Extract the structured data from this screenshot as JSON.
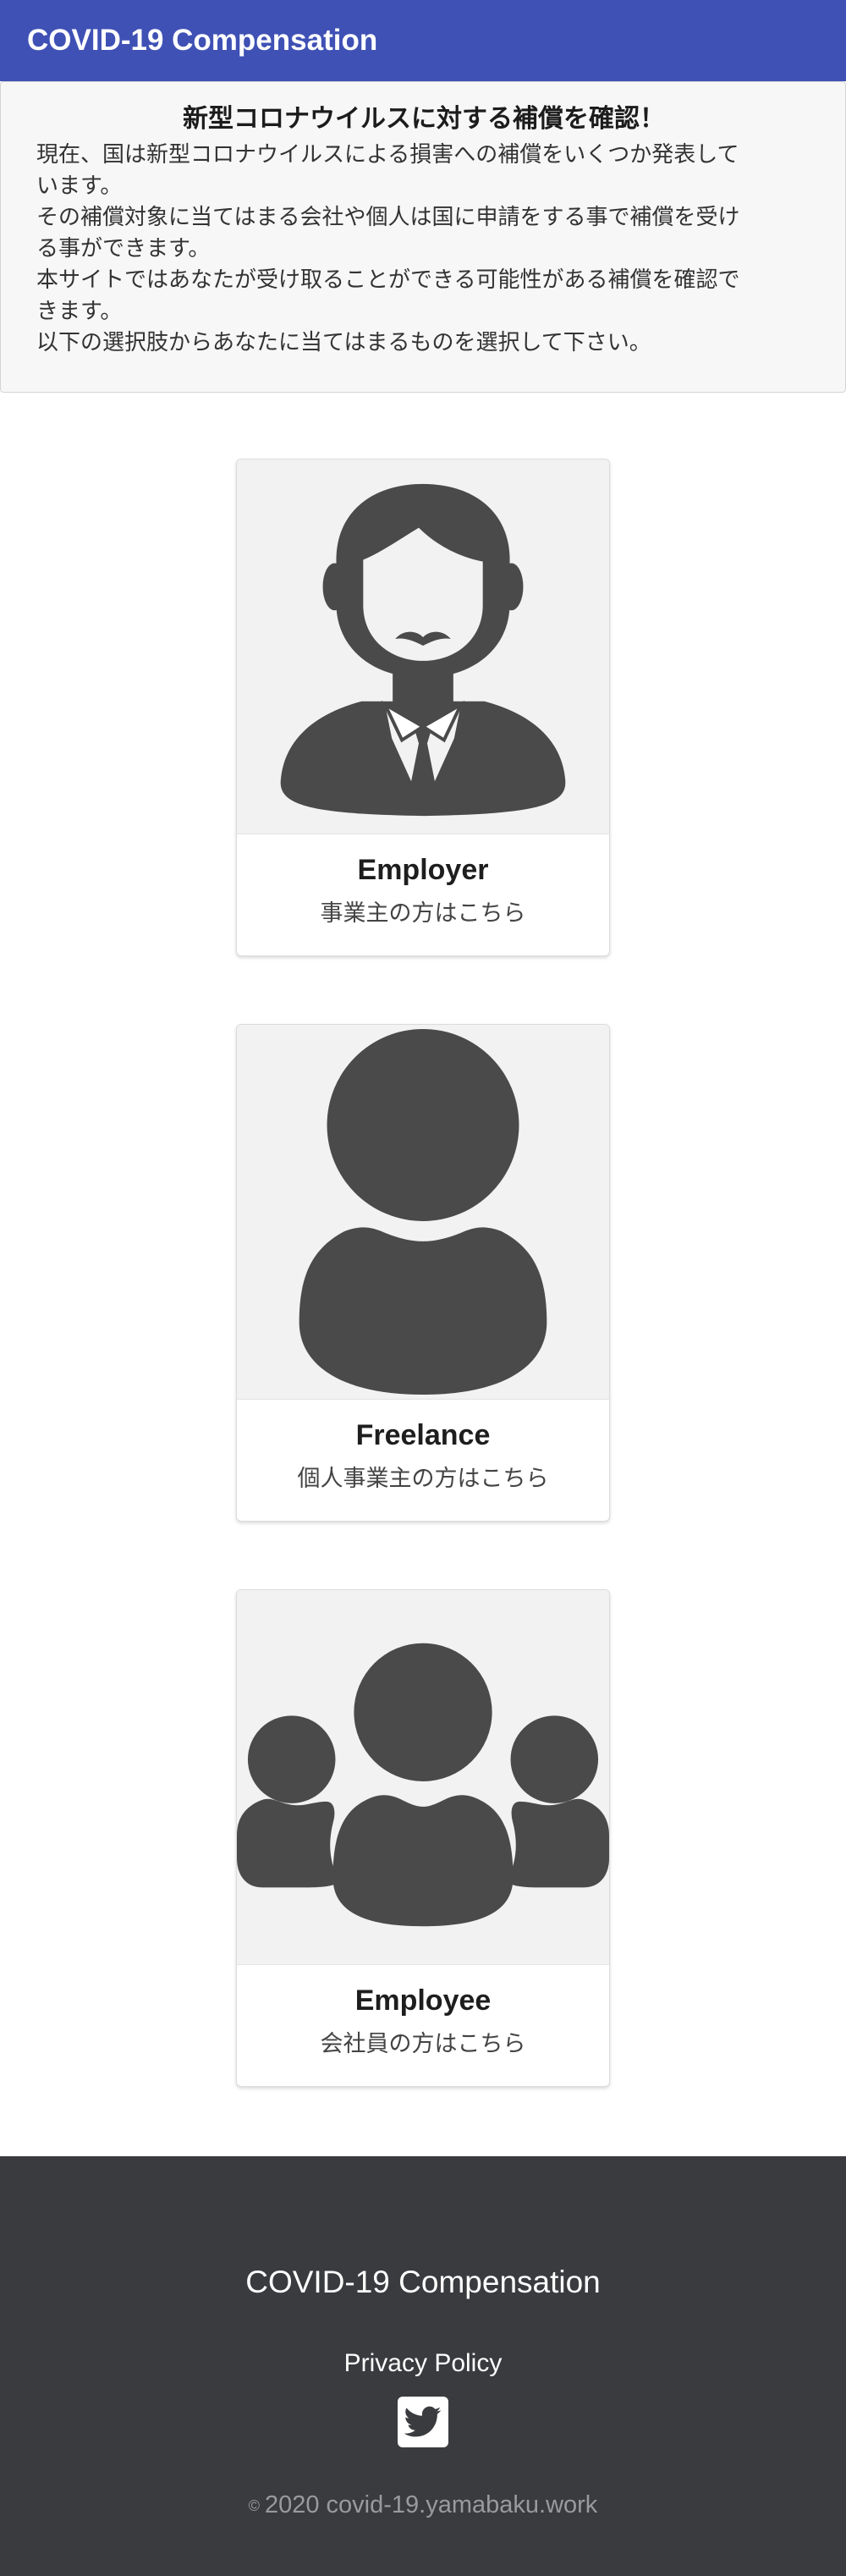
{
  "header": {
    "title": "COVID-19 Compensation"
  },
  "notice": {
    "title": "新型コロナウイルスに対する補償を確認！",
    "lines": [
      "現在、国は新型コロナウイルスによる損害への補償をいくつか発表して",
      "います。",
      "その補償対象に当てはまる会社や個人は国に申請をする事で補償を受け",
      "る事ができます。",
      "本サイトではあなたが受け取ることができる可能性がある補償を確認で",
      "きます。",
      "以下の選択肢からあなたに当てはまるものを選択して下さい。"
    ]
  },
  "cards": [
    {
      "icon": "businessman-icon",
      "title": "Employer",
      "subtitle": "事業主の方はこちら"
    },
    {
      "icon": "person-icon",
      "title": "Freelance",
      "subtitle": "個人事業主の方はこちら"
    },
    {
      "icon": "group-icon",
      "title": "Employee",
      "subtitle": "会社員の方はこちら"
    }
  ],
  "footer": {
    "title": "COVID-19 Compensation",
    "privacy_label": "Privacy Policy",
    "social_icon": "twitter-icon",
    "copyright_symbol": "©",
    "copyright_text": "2020 covid-19.yamabaku.work"
  },
  "colors": {
    "header_bg": "#3f51b5",
    "footer_bg": "#3a3b3f",
    "icon_fill": "#4a4a4a",
    "card_image_bg": "#f2f2f2"
  }
}
